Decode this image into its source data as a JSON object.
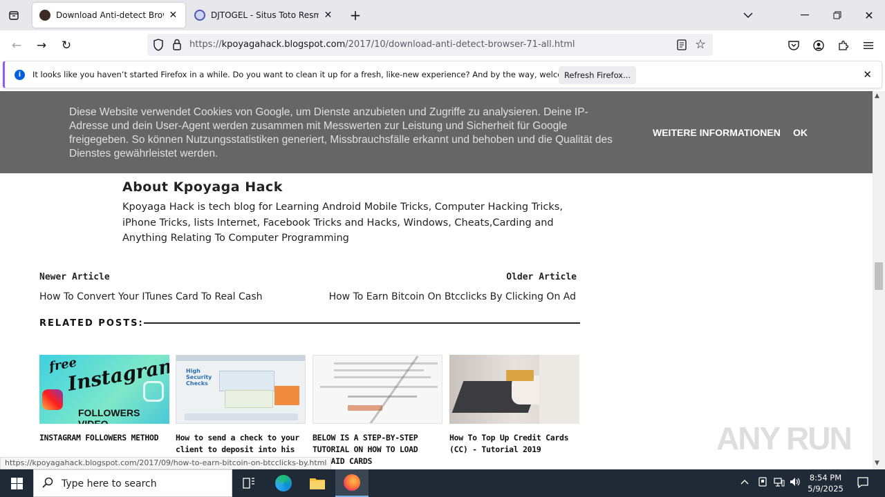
{
  "browser": {
    "tabs": [
      {
        "title": "Download Anti-detect Browser",
        "active": true
      },
      {
        "title": "DJTOGEL - Situs Toto Resmi Terg",
        "active": false
      }
    ],
    "url": {
      "scheme": "https://",
      "host": "kpoyagahack.blogspot.com",
      "path": "/2017/10/download-anti-detect-browser-71-all.html"
    },
    "notification": {
      "message": "It looks like you haven’t started Firefox in a while. Do you want to clean it up for a fresh, like-new experience? And by the way, welcome back!",
      "button": "Refresh Firefox..."
    },
    "status_url": "https://kpoyagahack.blogspot.com/2017/09/how-to-earn-bitcoin-on-btcclicks-by.html"
  },
  "cookie": {
    "text": "Diese Website verwendet Cookies von Google, um Dienste anzubieten und Zugriffe zu analysieren. Deine IP-Adresse und dein User-Agent werden zusammen mit Messwerten zur Leistung und Sicherheit für Google freigegeben. So können Nutzungsstatistiken generiert, Missbrauchsfälle erkannt und behoben und die Qualität des Dienstes gewährleistet werden.",
    "more_label": "WEITERE INFORMATIONEN",
    "ok_label": "OK"
  },
  "about": {
    "title": "About Kpoyaga Hack",
    "text": "Kpoyaga Hack is tech blog for Learning Android Mobile Tricks, Computer Hacking Tricks, iPhone Tricks, lists Internet, Facebook Tricks and Hacks, Windows, Cheats,Carding and Anything Relating To Computer Programming"
  },
  "pager": {
    "newer_label": "Newer Article",
    "newer_title": "How To Convert Your ITunes Card To Real Cash",
    "older_label": "Older Article",
    "older_title": "How To Earn Bitcoin On Btcclicks By Clicking On Ad"
  },
  "related": {
    "heading": "RELATED POSTS:",
    "posts": [
      {
        "title": "INSTAGRAM FOLLOWERS METHOD",
        "thumb_text_1": "free",
        "thumb_text_2": "Instagram",
        "thumb_text_3": "FOLLOWERS VIDEO"
      },
      {
        "title": "How to send a check to your client to deposit into his account",
        "thumb_text_1": "High Security Checks"
      },
      {
        "title": "BELOW IS A STEP-BY-STEP TUTORIAL ON HOW TO LOAD PREPAID CARDS"
      },
      {
        "title": "How To Top Up Credit Cards (CC) - Tutorial 2019"
      }
    ]
  },
  "watermark": "ANY RUN",
  "taskbar": {
    "search_placeholder": "Type here to search",
    "time": "8:54 PM",
    "date": "5/9/2025"
  },
  "colors": {
    "cookie_bg": "#666666",
    "taskbar_bg": "#1f2a36",
    "notif_accent": "#9059ff",
    "info_blue": "#0060df"
  }
}
